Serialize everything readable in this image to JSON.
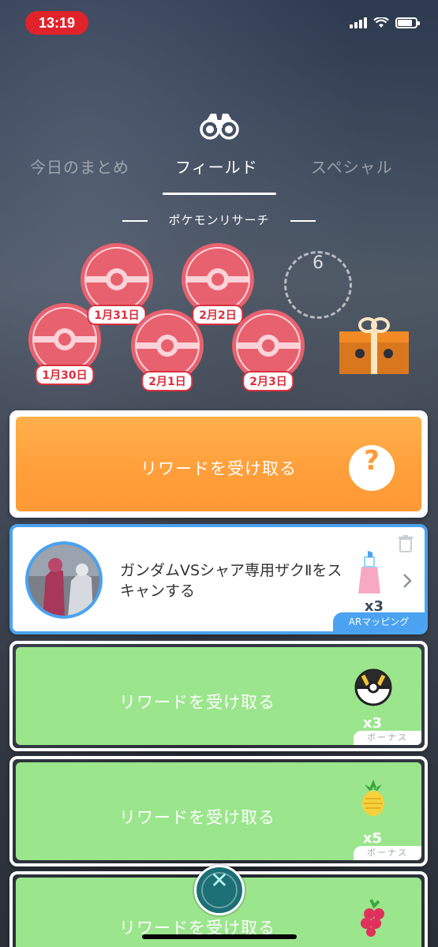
{
  "status_bar": {
    "time": "13:19"
  },
  "header": {
    "tabs": [
      {
        "label": "今日のまとめ",
        "active": false
      },
      {
        "label": "フィールド",
        "active": true
      },
      {
        "label": "スペシャル",
        "active": false
      }
    ],
    "section_label": "ポケモンリサーチ"
  },
  "stamps": [
    {
      "date": "1月30日"
    },
    {
      "date": "1月31日"
    },
    {
      "date": "2月1日"
    },
    {
      "date": "2月2日"
    },
    {
      "date": "2月3日"
    }
  ],
  "stamp_counter": "6",
  "cards": {
    "orange_reward": {
      "label": "リワードを受け取る",
      "icon": "question-mark-icon"
    },
    "task": {
      "text": "ガンダムVSシャア専用ザクⅡをスキャンする",
      "reward_qty": "x3",
      "tag": "ARマッピング",
      "reward_icon": "berry-spray-icon"
    },
    "reward_1": {
      "label": "リワードを受け取る",
      "qty": "x3",
      "bonus": "ボーナス",
      "icon": "ultra-ball-icon"
    },
    "reward_2": {
      "label": "リワードを受け取る",
      "qty": "x5",
      "bonus": "ボーナス",
      "icon": "pinap-berry-icon"
    },
    "reward_3": {
      "label": "リワードを受け取る",
      "icon": "razz-berry-icon"
    }
  },
  "colors": {
    "orange": "#ff9e3a",
    "green": "#9be58d",
    "blue": "#4aa2f0",
    "stamp_red": "#d8303f",
    "close_teal": "#1b6f75"
  }
}
